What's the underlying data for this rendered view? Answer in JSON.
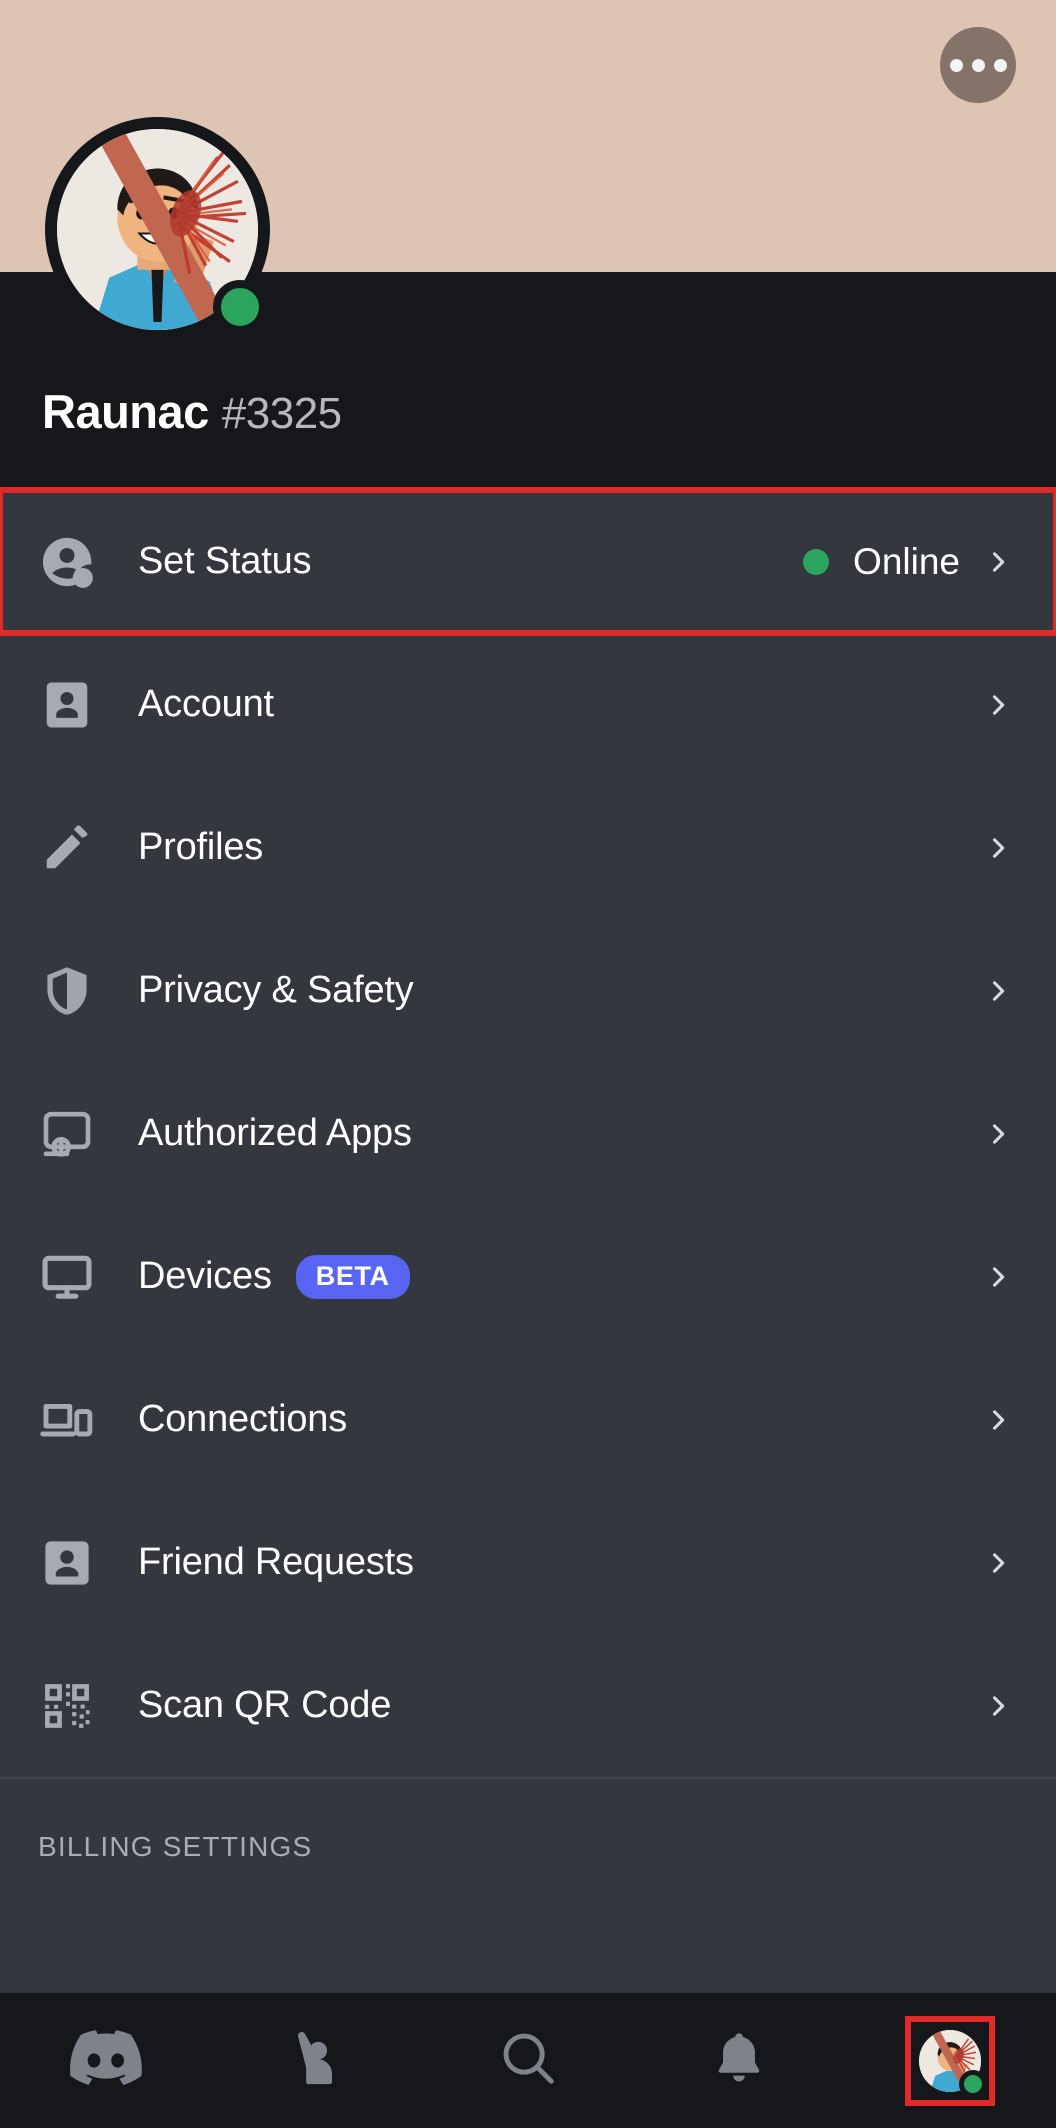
{
  "banner": {
    "color": "#DEC4B2",
    "more_button": {
      "icon": "more-horizontal-icon",
      "label": "More options"
    }
  },
  "profile": {
    "username": "Raunac",
    "discriminator": "#3325",
    "status": "online",
    "status_color": "#2BA55D",
    "avatar_alt": "User avatar"
  },
  "menu": {
    "items": [
      {
        "label": "Set Status",
        "icon": "person-status-icon",
        "value": "Online",
        "value_dot_color": "#2BA55D",
        "highlighted": true
      },
      {
        "label": "Account",
        "icon": "id-card-icon",
        "highlighted": false
      },
      {
        "label": "Profiles",
        "icon": "pencil-icon",
        "highlighted": false
      },
      {
        "label": "Privacy & Safety",
        "icon": "shield-icon",
        "highlighted": false
      },
      {
        "label": "Authorized Apps",
        "icon": "authorized-apps-icon",
        "highlighted": false
      },
      {
        "label": "Devices",
        "icon": "monitor-icon",
        "badge": "BETA",
        "badge_color": "#5865F2",
        "highlighted": false
      },
      {
        "label": "Connections",
        "icon": "devices-icon",
        "highlighted": false
      },
      {
        "label": "Friend Requests",
        "icon": "person-badge-icon",
        "highlighted": false
      },
      {
        "label": "Scan QR Code",
        "icon": "qr-code-icon",
        "highlighted": false
      }
    ]
  },
  "sections": {
    "billing_heading": "BILLING SETTINGS"
  },
  "bottom_nav": {
    "items": [
      {
        "name": "servers",
        "icon": "discord-logo-icon",
        "highlighted": false
      },
      {
        "name": "friends",
        "icon": "friends-icon",
        "highlighted": false
      },
      {
        "name": "search",
        "icon": "search-icon",
        "highlighted": false
      },
      {
        "name": "notifications",
        "icon": "bell-icon",
        "highlighted": false
      },
      {
        "name": "profile",
        "icon": "avatar-icon",
        "highlighted": true
      }
    ],
    "highlight_color": "#E02A2A"
  },
  "theme": {
    "header_bg": "#16171A",
    "list_bg": "#35373E",
    "text_primary": "#FFFFFF",
    "text_muted": "#A9ADB4",
    "icon_gray": "#A6AAB1",
    "accent": "#5865F2",
    "highlight": "#E02A2A"
  }
}
